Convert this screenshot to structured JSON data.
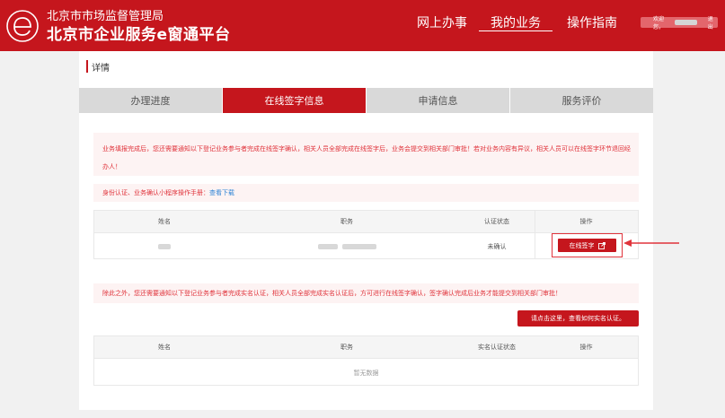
{
  "header": {
    "org_name": "北京市市场监督管理局",
    "platform_name": "北京市企业服务e窗通平台",
    "nav": [
      "网上办事",
      "我的业务",
      "操作指南"
    ],
    "active_nav": "我的业务",
    "user_greeting": "欢迎您，",
    "logout": "退出"
  },
  "detail_title": "详情",
  "tabs": [
    "办理进度",
    "在线签字信息",
    "申请信息",
    "服务评价"
  ],
  "active_tab": "在线签字信息",
  "notice1": "业务填报完成后，您还需要通知以下登记业务参与者完成在线签字确认，相关人员全部完成在线签字后，业务会提交到相关部门审批！若对业务内容有异议，相关人员可以在线签字环节退回经办人！",
  "notice2": {
    "text": "身份认证、业务确认小程序操作手册：",
    "link": "查看下载"
  },
  "sign_table": {
    "headers": [
      "姓名",
      "职务",
      "认证状态",
      "操作"
    ],
    "rows": [
      {
        "status": "未确认",
        "action": "在线签字"
      }
    ]
  },
  "notice3": "除此之外，您还需要通知以下登记业务参与者完成实名认证，相关人员全部完成实名认证后，方可进行在线签字确认，签字确认完成后业务才能提交到相关部门审批！",
  "realname_button": "请点击这里，查看如何实名认证。",
  "realname_table": {
    "headers": [
      "姓名",
      "职务",
      "实名认证状态",
      "操作"
    ],
    "empty_text": "暂无数据"
  },
  "colors": {
    "brand_red": "#c5161d",
    "notice_bg": "#fdf3f3",
    "notice_text": "#e0333b",
    "link": "#2f85d6"
  }
}
